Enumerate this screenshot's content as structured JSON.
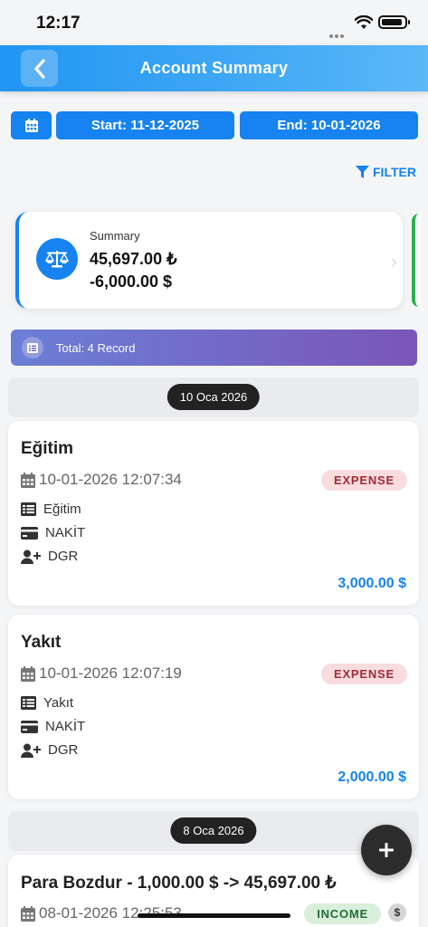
{
  "status": {
    "time": "12:17"
  },
  "header": {
    "title": "Account Summary"
  },
  "dates": {
    "start": "Start: 11-12-2025",
    "end": "End: 10-01-2026"
  },
  "filter": {
    "label": "FILTER"
  },
  "summary": {
    "label": "Summary",
    "value_try": "45,697.00 ₺",
    "value_usd": "-6,000.00 $"
  },
  "total": {
    "label": "Total: 4 Record"
  },
  "groups": [
    {
      "date": "10 Oca 2026"
    },
    {
      "date": "8 Oca 2026"
    }
  ],
  "transactions": [
    {
      "title": "Eğitim",
      "datetime": "10-01-2026 12:07:34",
      "type": "EXPENSE",
      "category": "Eğitim",
      "account": "NAKİT",
      "person": "DGR",
      "amount": "3,000.00 $"
    },
    {
      "title": "Yakıt",
      "datetime": "10-01-2026 12:07:19",
      "type": "EXPENSE",
      "category": "Yakıt",
      "account": "NAKİT",
      "person": "DGR",
      "amount": "2,000.00 $"
    },
    {
      "title": "Para Bozdur - 1,000.00 $ -> 45,697.00 ₺",
      "datetime": "08-01-2026 12:25:53",
      "type": "INCOME",
      "currency_symbol": "$"
    }
  ],
  "colors": {
    "primary": "#1683f0",
    "expense_badge": "#f8dcdf",
    "income_badge": "#d9efdc",
    "accent_green": "#2eb34a"
  },
  "icons": [
    "wifi-icon",
    "battery-icon",
    "back-chevron-icon",
    "calendar-icon",
    "filter-icon",
    "balance-scale-icon",
    "list-icon",
    "person-add-icon",
    "credit-card-icon",
    "plus-icon"
  ]
}
